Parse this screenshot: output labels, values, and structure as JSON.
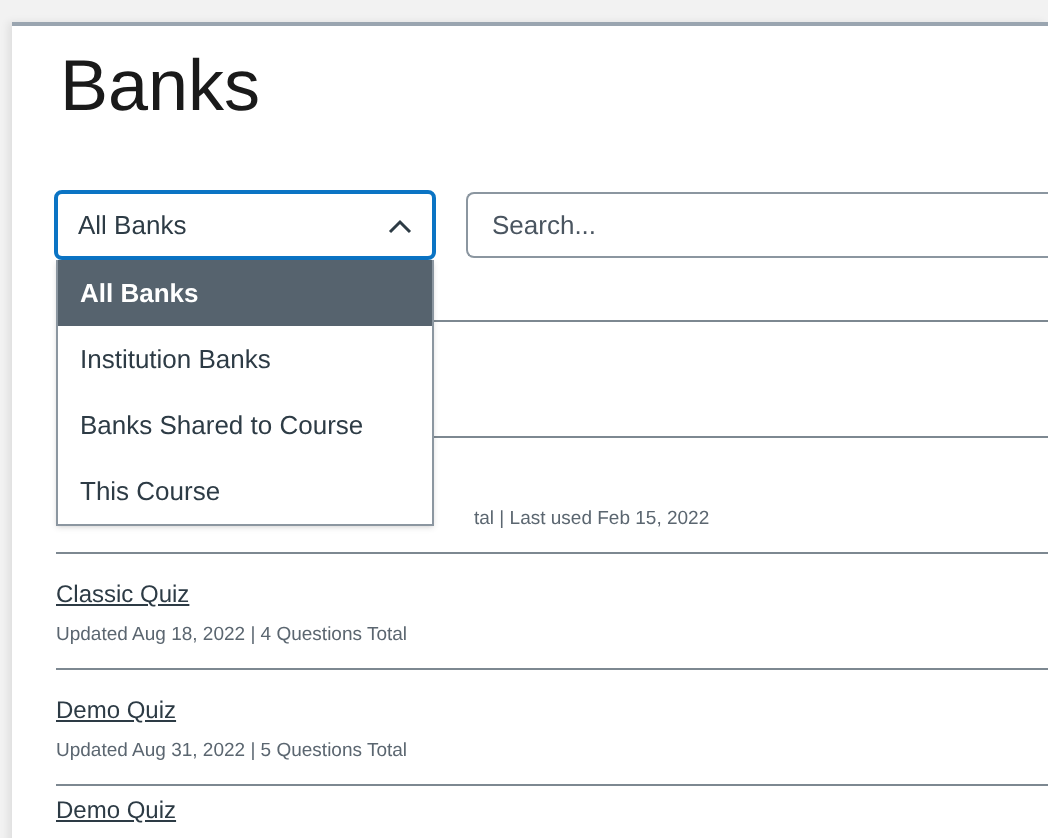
{
  "page": {
    "title": "Banks"
  },
  "filter": {
    "value": "All Banks",
    "expanded": true,
    "options": [
      {
        "label": "All Banks",
        "selected": true
      },
      {
        "label": "Institution Banks",
        "selected": false
      },
      {
        "label": "Banks Shared to Course",
        "selected": false
      },
      {
        "label": "This Course",
        "selected": false
      }
    ]
  },
  "search": {
    "placeholder": "Search..."
  },
  "banks": [
    {
      "kind": "hidden"
    },
    {
      "kind": "partial",
      "meta": "tal | Last used Feb 15, 2022"
    },
    {
      "kind": "full",
      "name": "Classic Quiz",
      "meta": "Updated Aug 18, 2022 | 4 Questions Total"
    },
    {
      "kind": "full",
      "name": "Demo Quiz",
      "meta": "Updated Aug 31, 2022 | 5 Questions Total"
    },
    {
      "kind": "full",
      "name": "Demo Quiz"
    }
  ]
}
